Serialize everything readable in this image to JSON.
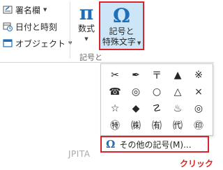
{
  "ribbon": {
    "commands": {
      "signature_line": "署名欄",
      "date_time": "日付と時刻",
      "object": "オブジェクト"
    },
    "equation": {
      "label": "数式",
      "glyph": "π"
    },
    "symbol": {
      "glyph": "Ω",
      "label_line1": "記号と",
      "label_line2": "特殊文字"
    },
    "group_label": "記号と"
  },
  "gallery": {
    "rows": [
      [
        "✂",
        "✒",
        "〒",
        "▲",
        "※"
      ],
      [
        "☎",
        "◎",
        "○",
        "△",
        "×"
      ],
      [
        "☆",
        "◆",
        "☡",
        "♨",
        "◎"
      ],
      [
        "㊕",
        "㈱",
        "㈲",
        "㈹",
        "㊞"
      ]
    ],
    "more_symbols": "その他の記号(M)..."
  },
  "watermark": "JPITA",
  "callout": "クリック",
  "colors": {
    "accent_blue": "#1e6fb8",
    "highlight_red": "#d9242b",
    "selected_fill": "#cde6f7"
  }
}
